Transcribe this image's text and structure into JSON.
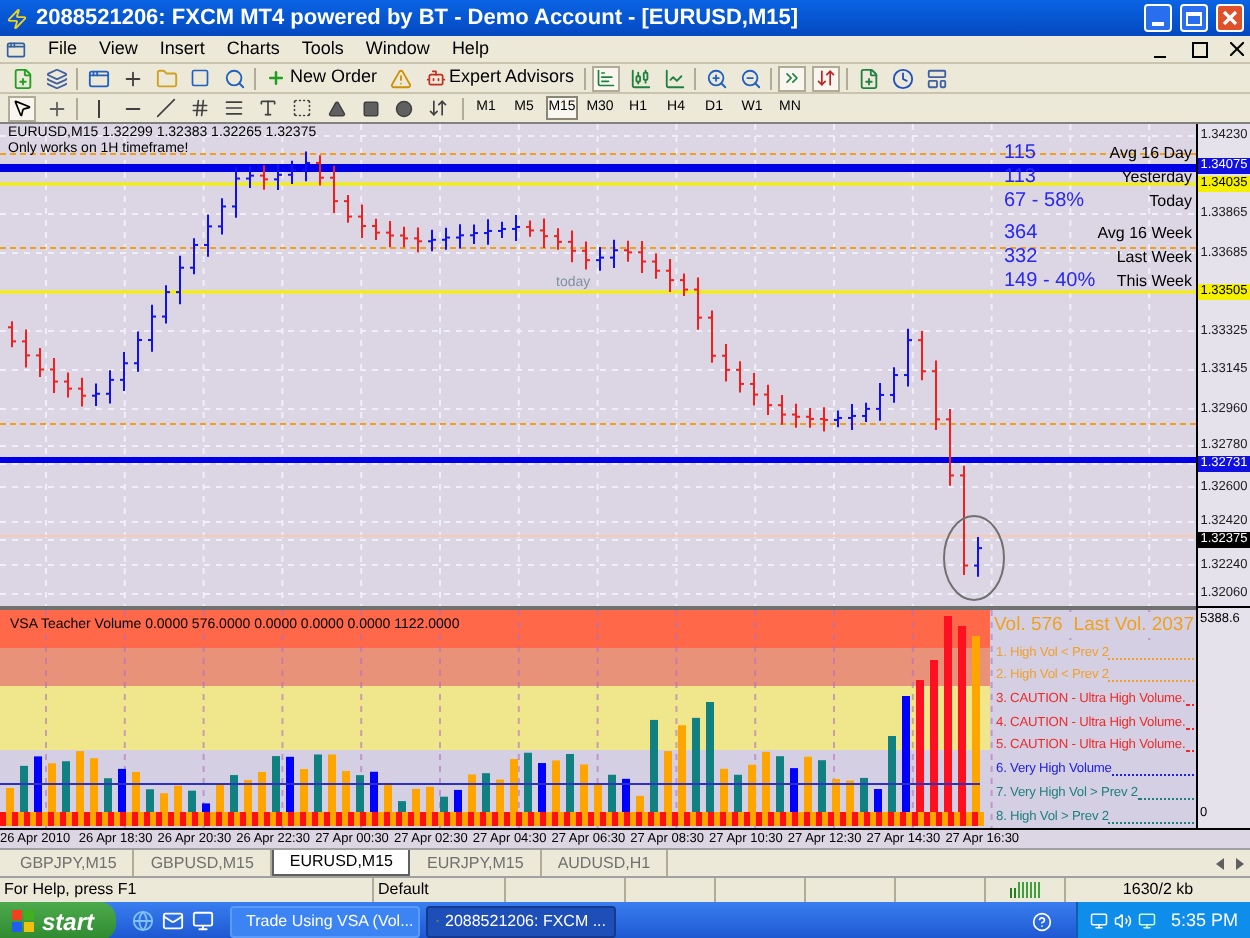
{
  "window": {
    "title": "2088521206: FXCM MT4 powered by BT - Demo Account - [EURUSD,M15]"
  },
  "menu": [
    "File",
    "View",
    "Insert",
    "Charts",
    "Tools",
    "Window",
    "Help"
  ],
  "toolbar": {
    "buttons": [
      "New Order",
      "Expert Advisors"
    ]
  },
  "timeframes": [
    {
      "label": "M1",
      "selected": false
    },
    {
      "label": "M5",
      "selected": false
    },
    {
      "label": "M15",
      "selected": true
    },
    {
      "label": "M30",
      "selected": false
    },
    {
      "label": "H1",
      "selected": false
    },
    {
      "label": "H4",
      "selected": false
    },
    {
      "label": "D1",
      "selected": false
    },
    {
      "label": "W1",
      "selected": false
    },
    {
      "label": "MN",
      "selected": false
    }
  ],
  "chart": {
    "header": "EURUSD,M15 1.32299 1.32383 1.32265 1.32375",
    "note": "Only works on 1H timeframe!",
    "today_label": "today",
    "stat_groups": [
      {
        "rows": [
          {
            "value": "115",
            "label": "Avg 16 Day"
          },
          {
            "value": "113",
            "label": "Yesterday"
          },
          {
            "value": "67 - 58%",
            "label": "Today"
          }
        ]
      },
      {
        "rows": [
          {
            "value": "364",
            "label": "Avg 16 Week"
          },
          {
            "value": "332",
            "label": "Last Week"
          },
          {
            "value": "149 - 40%",
            "label": "This Week"
          }
        ]
      }
    ],
    "price_axis": [
      {
        "label": "1.34230",
        "kind": "tick"
      },
      {
        "label": "1.34075",
        "kind": "blue"
      },
      {
        "label": "1.34035",
        "kind": "yellow"
      },
      {
        "label": "1.33865",
        "kind": "tick"
      },
      {
        "label": "1.33685",
        "kind": "tick"
      },
      {
        "label": "1.33505",
        "kind": "yellow"
      },
      {
        "label": "1.33325",
        "kind": "tick"
      },
      {
        "label": "1.33145",
        "kind": "tick"
      },
      {
        "label": "1.32960",
        "kind": "tick"
      },
      {
        "label": "1.32780",
        "kind": "tick"
      },
      {
        "label": "1.32731",
        "kind": "blue"
      },
      {
        "label": "1.32600",
        "kind": "tick"
      },
      {
        "label": "1.32420",
        "kind": "tick"
      },
      {
        "label": "1.32375",
        "kind": "current"
      },
      {
        "label": "1.32240",
        "kind": "tick"
      },
      {
        "label": "1.32060",
        "kind": "tick"
      }
    ]
  },
  "indicator": {
    "header": "VSA Teacher Volume 0.0000 576.0000 0.0000 0.0000 0.0000 1122.0000",
    "vol": "Vol. 576",
    "last_vol": "Last Vol. 2037",
    "legend": [
      {
        "text": "1. High Vol < Prev 2",
        "color": "#f0a030"
      },
      {
        "text": "2. High Vol < Prev 2",
        "color": "#f0a030"
      },
      {
        "text": "3. CAUTION - Ultra High Volume.",
        "color": "#ee2a2a"
      },
      {
        "text": "4. CAUTION - Ultra High Volume.",
        "color": "#ee2a2a"
      },
      {
        "text": "5. CAUTION - Ultra High Volume.",
        "color": "#ee2a2a"
      },
      {
        "text": "6. Very High Volume",
        "color": "#2020e0"
      },
      {
        "text": "7. Very High Vol > Prev 2",
        "color": "#208080"
      },
      {
        "text": "8. High Vol > Prev 2",
        "color": "#208080"
      }
    ],
    "axis": [
      "5388.6",
      "0"
    ]
  },
  "time_axis": [
    "26 Apr 2010",
    "26 Apr 18:30",
    "26 Apr 20:30",
    "26 Apr 22:30",
    "27 Apr 00:30",
    "27 Apr 02:30",
    "27 Apr 04:30",
    "27 Apr 06:30",
    "27 Apr 08:30",
    "27 Apr 10:30",
    "27 Apr 12:30",
    "27 Apr 14:30",
    "27 Apr 16:30"
  ],
  "tabs": [
    {
      "label": "GBPJPY,M15",
      "selected": false
    },
    {
      "label": "GBPUSD,M15",
      "selected": false
    },
    {
      "label": "EURUSD,M15",
      "selected": true
    },
    {
      "label": "EURJPY,M15",
      "selected": false
    },
    {
      "label": "AUDUSD,H1",
      "selected": false
    }
  ],
  "status_bar": [
    "For Help, press F1",
    "Default",
    "1630/2 kb"
  ],
  "taskbar": {
    "start": "start",
    "tasks": [
      {
        "label": "Trade Using VSA (Vol...",
        "selected": false
      },
      {
        "label": "2088521206: FXCM ...",
        "selected": true
      }
    ],
    "clock": "5:35 PM"
  }
}
